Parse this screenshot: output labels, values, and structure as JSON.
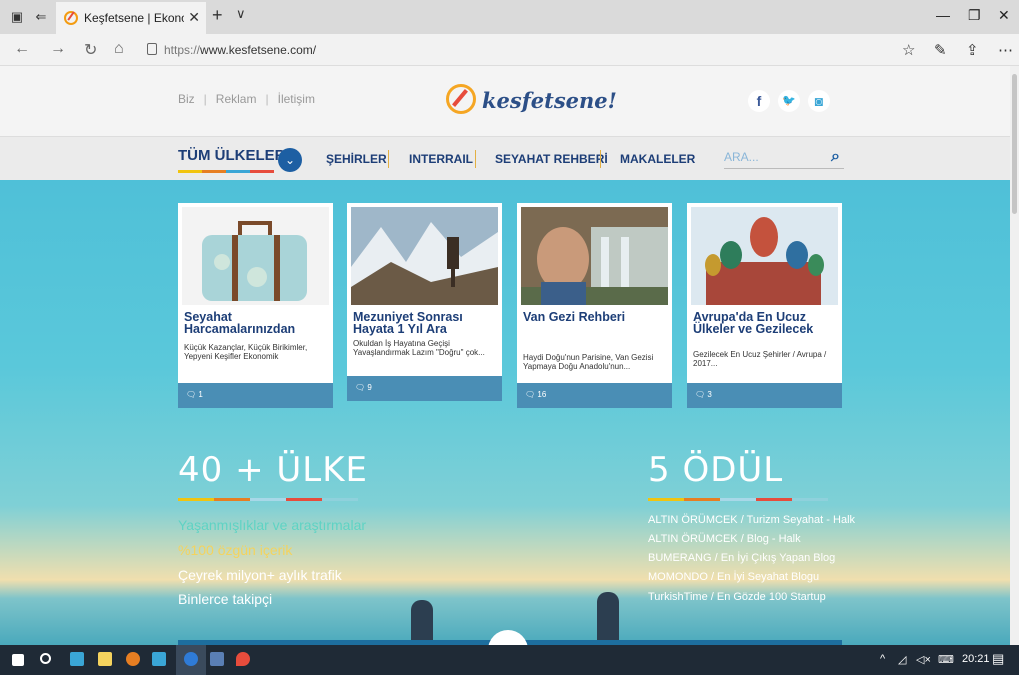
{
  "browser": {
    "tab_title": "Keşfetsene | Ekonomik S",
    "url_prefix": "https://",
    "url_host": "www.kesfetsene.com/"
  },
  "site": {
    "top_links": [
      "Biz",
      "Reklam",
      "İletişim"
    ],
    "logo_text": "kesfetsene!",
    "social": [
      "f",
      "t",
      "ig"
    ],
    "nav": {
      "all_countries": "TÜM ÜLKELER",
      "links": [
        "ŞEHİRLER",
        "INTERRAIL",
        "SEYAHAT REHBERİ",
        "MAKALELER"
      ],
      "search_placeholder": "ARA..."
    }
  },
  "cards": [
    {
      "title": "Seyahat Harcamalarınızdan",
      "desc": "Küçük Kazançlar, Küçük Birikimler, Yepyeni Keşifler Ekonomik",
      "comments": "1"
    },
    {
      "title": "Mezuniyet Sonrası Hayata 1 Yıl Ara",
      "desc": "Okuldan İş Hayatına Geçişi Yavaşlandırmak Lazım \"Doğru\" çok...",
      "comments": "9"
    },
    {
      "title": "Van Gezi Rehberi",
      "desc": "Haydi Doğu'nun Parisine, Van Gezisi Yapmaya Doğu Anadolu'nun...",
      "comments": "16"
    },
    {
      "title": "Avrupa'da En Ucuz Ülkeler ve Gezilecek",
      "desc": "Gezilecek En Ucuz Şehirler / Avrupa / 2017...",
      "comments": "3"
    }
  ],
  "stats": {
    "countries_title": "40 + ÜLKE",
    "countries_items": [
      "Yaşanmışlıklar ve araştırmalar",
      "%100 özgün içerik",
      "Çeyrek milyon+ aylık trafik",
      "Binlerce takipçi"
    ],
    "awards_title": "5 ÖDÜL",
    "awards_items": [
      "ALTIN ÖRÜMCEK / Turizm Seyahat - Halk",
      "ALTIN ÖRÜMCEK / Blog - Halk",
      "BUMERANG / En İyi Çıkış Yapan Blog",
      "MOMONDO / En İyi Seyahat Blogu",
      "TurkishTime / En Gözde 100 Startup"
    ]
  },
  "taskbar": {
    "time": "20:21"
  },
  "colors": {
    "brand_blue": "#1d3e77",
    "accent_yellow": "#f1c40f",
    "accent_orange": "#e67e22",
    "accent_red": "#e74c3c",
    "accent_cyan": "#3aa6d6"
  }
}
